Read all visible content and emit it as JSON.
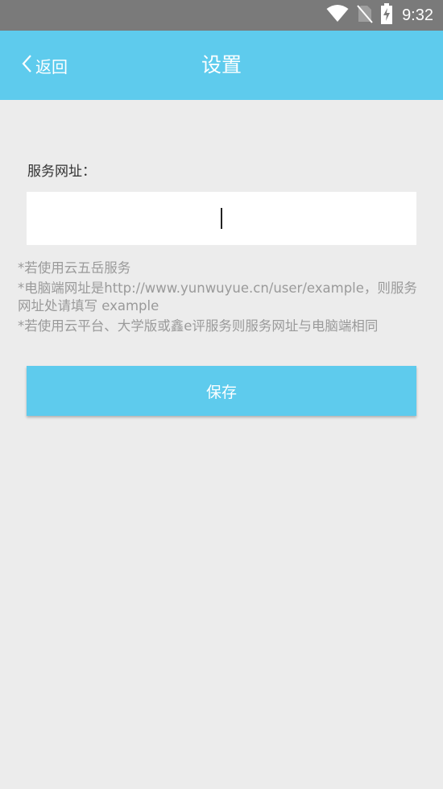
{
  "status_bar": {
    "time": "9:32",
    "icons": [
      "wifi-icon",
      "no-sim-icon",
      "battery-charging-icon"
    ]
  },
  "app_bar": {
    "back_label": "返回",
    "title": "设置"
  },
  "form": {
    "field_label": "服务网址：",
    "url_value": "",
    "url_placeholder": ""
  },
  "hints": [
    "*若使用云五岳服务",
    "*电脑端网址是http://www.yunwuyue.cn/user/example，则服务网址处请填写 example",
    "*若使用云平台、大学版或鑫e评服务则服务网址与电脑端相同"
  ],
  "actions": {
    "save_label": "保存"
  },
  "colors": {
    "accent": "#5ecbed",
    "background": "#ececec",
    "status_bar": "#7a7a7a",
    "hint_text": "#9a9a9a"
  }
}
